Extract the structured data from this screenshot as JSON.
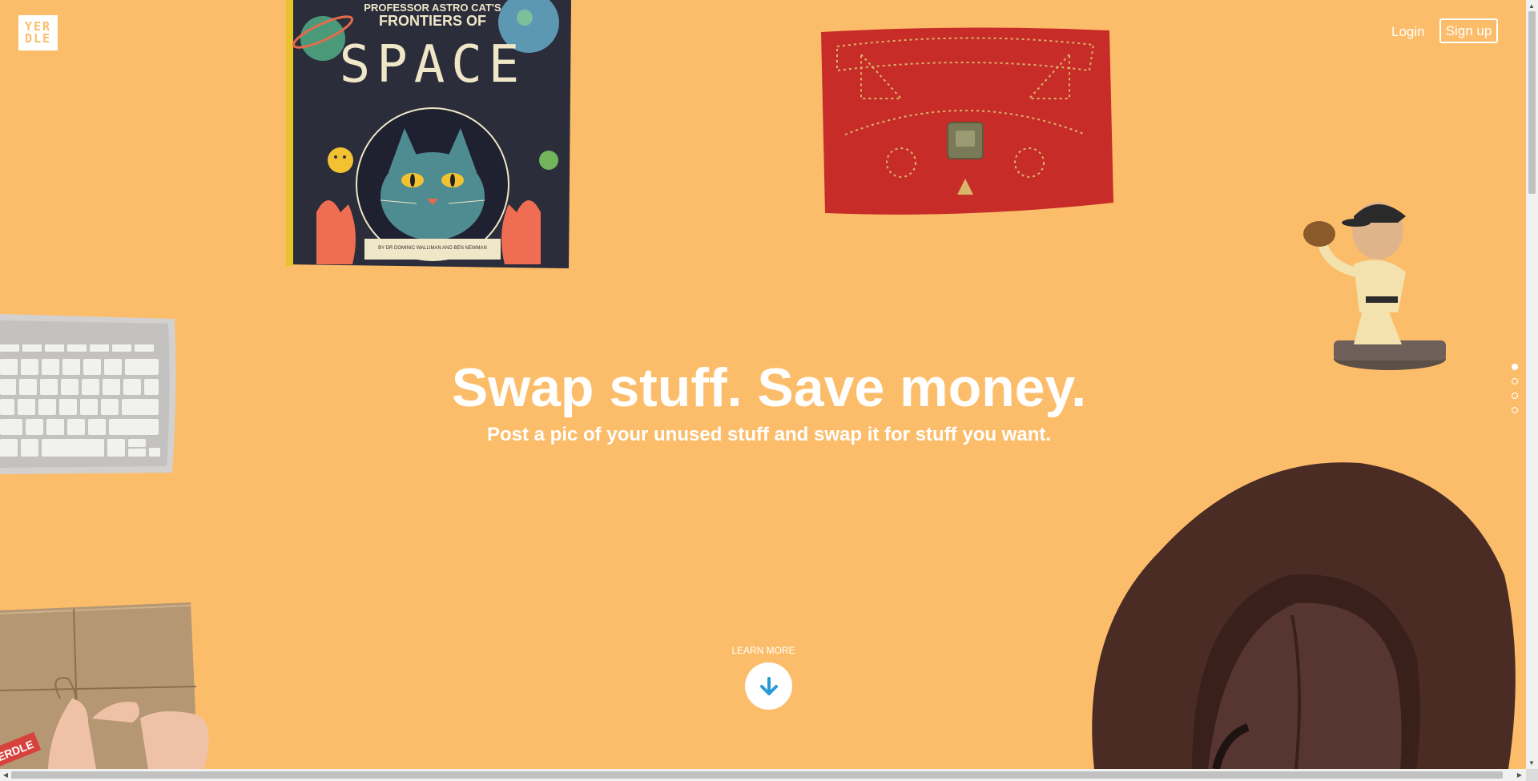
{
  "logo": {
    "line1": "YER",
    "line2": "DLE"
  },
  "nav": {
    "login": "Login",
    "signup": "Sign up"
  },
  "hero": {
    "title": "Swap stuff. Save money.",
    "subtitle": "Post a pic of your unused stuff and swap it for stuff you want."
  },
  "learn_more": {
    "label": "LEARN MORE"
  },
  "book": {
    "line1": "PROFESSOR ASTRO CAT'S",
    "line2": "FRONTIERS OF",
    "line3": "SPACE",
    "credit": "BY DR DOMINIC WALLIMAN AND BEN NEWMAN"
  },
  "package": {
    "tag": "ERDLE"
  },
  "pagination": {
    "slides": 4,
    "active": 1
  },
  "colors": {
    "background": "#fcbd6b",
    "accent": "#2a9ad6",
    "white": "#ffffff"
  }
}
